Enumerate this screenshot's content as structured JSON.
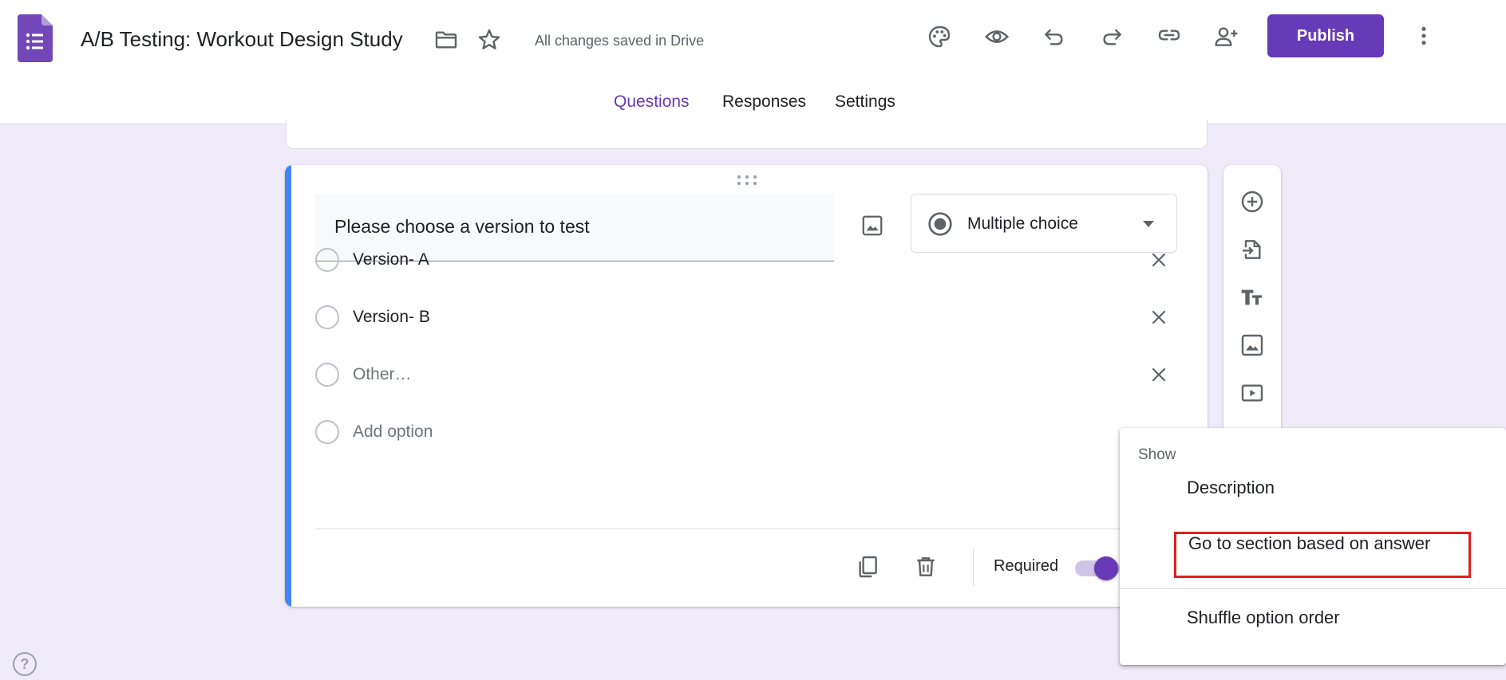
{
  "header": {
    "title": "A/B Testing: Workout Design Study",
    "save_status": "All changes saved in Drive",
    "publish_label": "Publish",
    "icons": [
      "forms-logo-icon",
      "folder-icon",
      "star-icon",
      "palette-icon",
      "preview-eye-icon",
      "undo-icon",
      "redo-icon",
      "link-icon",
      "add-collaborator-icon",
      "more-vert-icon"
    ]
  },
  "tabs": [
    {
      "label": "Questions",
      "active": true
    },
    {
      "label": "Responses",
      "active": false
    },
    {
      "label": "Settings",
      "active": false
    }
  ],
  "question": {
    "title": "Please choose a version to test",
    "type_label": "Multiple choice",
    "options": [
      {
        "label": "Version- A",
        "muted": false
      },
      {
        "label": "Version- B",
        "muted": false
      },
      {
        "label": "Other…",
        "muted": true
      }
    ],
    "add_option_label": "Add option",
    "required_label": "Required",
    "required_on": true
  },
  "toolbar": {
    "icons": [
      "add-question-icon",
      "import-questions-icon",
      "add-title-icon",
      "add-image-icon",
      "add-video-icon",
      "add-section-icon"
    ]
  },
  "menu": {
    "header": "Show",
    "items": [
      {
        "label": "Description"
      },
      {
        "label": "Go to section based on answer",
        "highlighted": true
      },
      {
        "label": "Shuffle option order"
      }
    ]
  },
  "colors": {
    "accent": "#673ab7",
    "background": "#f0ebf8",
    "card_accent": "#4285f4",
    "highlight": "#e0201e"
  }
}
